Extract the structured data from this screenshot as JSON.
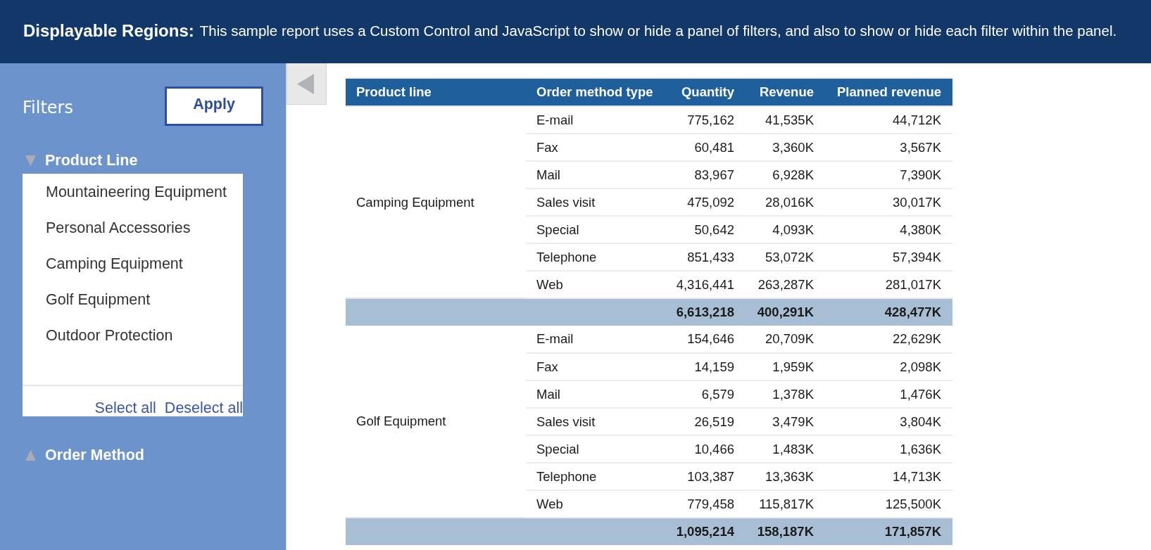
{
  "header": {
    "title": "Displayable Regions:",
    "description": "This sample report uses a Custom Control and JavaScript to show or hide a panel of filters, and also to show or hide each filter within the panel."
  },
  "filter_panel": {
    "title": "Filters",
    "apply_button": "Apply",
    "sections": [
      {
        "label": "Product Line",
        "expanded": true,
        "options": [
          {
            "label": "Mountaineering Equipment",
            "selected": false
          },
          {
            "label": "Personal Accessories",
            "selected": false
          },
          {
            "label": "Camping Equipment",
            "selected": false
          },
          {
            "label": "Golf Equipment",
            "selected": false
          },
          {
            "label": "Outdoor Protection",
            "selected": false
          }
        ],
        "links": [
          "Select all",
          "Deselect all"
        ]
      },
      {
        "label": "Order Method",
        "expanded": false
      }
    ]
  },
  "table": {
    "columns": [
      {
        "label": "Product line",
        "kind": "text"
      },
      {
        "label": "Order method type",
        "kind": "text"
      },
      {
        "label": "Quantity",
        "kind": "number"
      },
      {
        "label": "Revenue",
        "kind": "number"
      },
      {
        "label": "Planned revenue",
        "kind": "number"
      }
    ],
    "groups": [
      {
        "product_line": "Camping Equipment",
        "rows": [
          [
            "E-mail",
            "775,162",
            "41,535K",
            "44,712K"
          ],
          [
            "Fax",
            "60,481",
            "3,360K",
            "3,567K"
          ],
          [
            "Mail",
            "83,967",
            "6,928K",
            "7,390K"
          ],
          [
            "Sales visit",
            "475,092",
            "28,016K",
            "30,017K"
          ],
          [
            "Special",
            "50,642",
            "4,093K",
            "4,380K"
          ],
          [
            "Telephone",
            "851,433",
            "53,072K",
            "57,394K"
          ],
          [
            "Web",
            "4,316,441",
            "263,287K",
            "281,017K"
          ]
        ],
        "totals": [
          "6,613,218",
          "400,291K",
          "428,477K"
        ]
      },
      {
        "product_line": "Golf Equipment",
        "rows": [
          [
            "E-mail",
            "154,646",
            "20,709K",
            "22,629K"
          ],
          [
            "Fax",
            "14,159",
            "1,959K",
            "2,098K"
          ],
          [
            "Mail",
            "6,579",
            "1,378K",
            "1,476K"
          ],
          [
            "Sales visit",
            "26,519",
            "3,479K",
            "3,804K"
          ],
          [
            "Special",
            "10,466",
            "1,483K",
            "1,636K"
          ],
          [
            "Telephone",
            "103,387",
            "13,363K",
            "14,713K"
          ],
          [
            "Web",
            "779,458",
            "115,817K",
            "125,500K"
          ]
        ],
        "totals": [
          "1,095,214",
          "158,187K",
          "171,857K"
        ]
      }
    ]
  }
}
